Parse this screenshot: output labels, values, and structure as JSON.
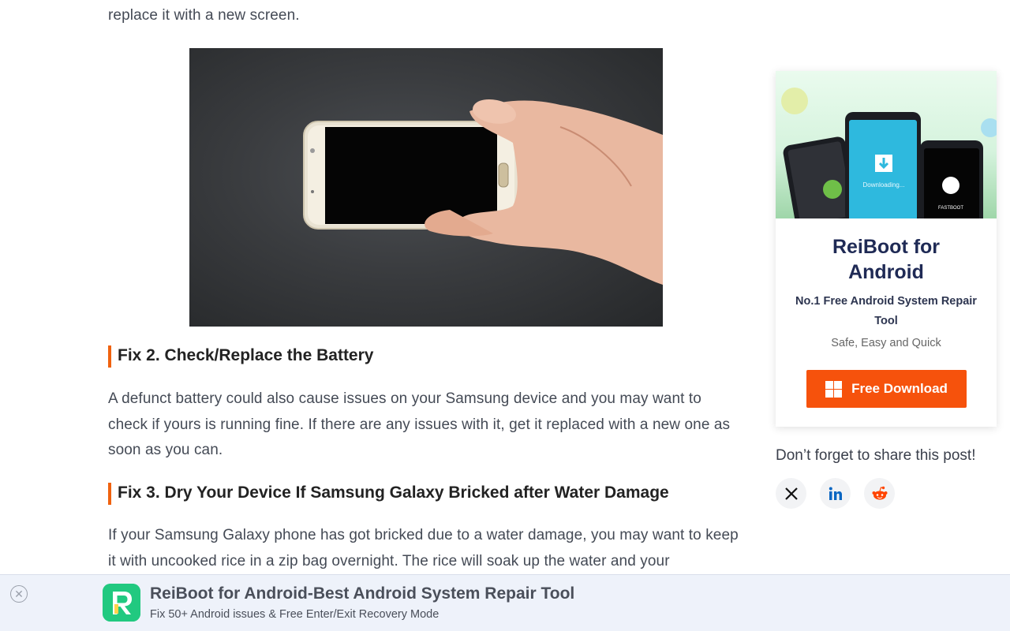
{
  "article": {
    "intro_tail": "replace it with a new screen.",
    "fix2_heading": "Fix 2. Check/Replace the Battery",
    "fix2_body": "A defunct battery could also cause issues on your Samsung device and you may want to check if yours is running fine. If there are any issues with it, get it replaced with a new one as soon as you can.",
    "fix3_heading": "Fix 3. Dry Your Device If Samsung Galaxy Bricked after Water Damage",
    "fix3_body": "If your Samsung Galaxy phone has got bricked due to a water damage, you may want to keep it with uncooked rice in a zip bag overnight. The rice will soak up the water and your"
  },
  "sidebar": {
    "product_title": "ReiBoot for Android",
    "product_subtitle": "No.1 Free Android System Repair Tool",
    "tagline": "Safe, Easy and Quick",
    "download_label": "Free Download",
    "banner_status_text": "Downloading...",
    "banner_fastboot_text": "FASTBOOT",
    "share_prompt": "Don’t forget to share this post!",
    "share_icons": [
      "x-icon",
      "linkedin-icon",
      "reddit-icon"
    ]
  },
  "bottom_bar": {
    "title": "ReiBoot for Android-Best Android System Repair Tool",
    "subtitle": "Fix 50+ Android issues & Free Enter/Exit Recovery Mode"
  },
  "colors": {
    "accent_orange": "#f6520c",
    "heading_bar": "#f0620f",
    "app_icon_green": "#21c980",
    "linkedin_blue": "#0a66c2",
    "reddit_orange": "#ff4500"
  }
}
